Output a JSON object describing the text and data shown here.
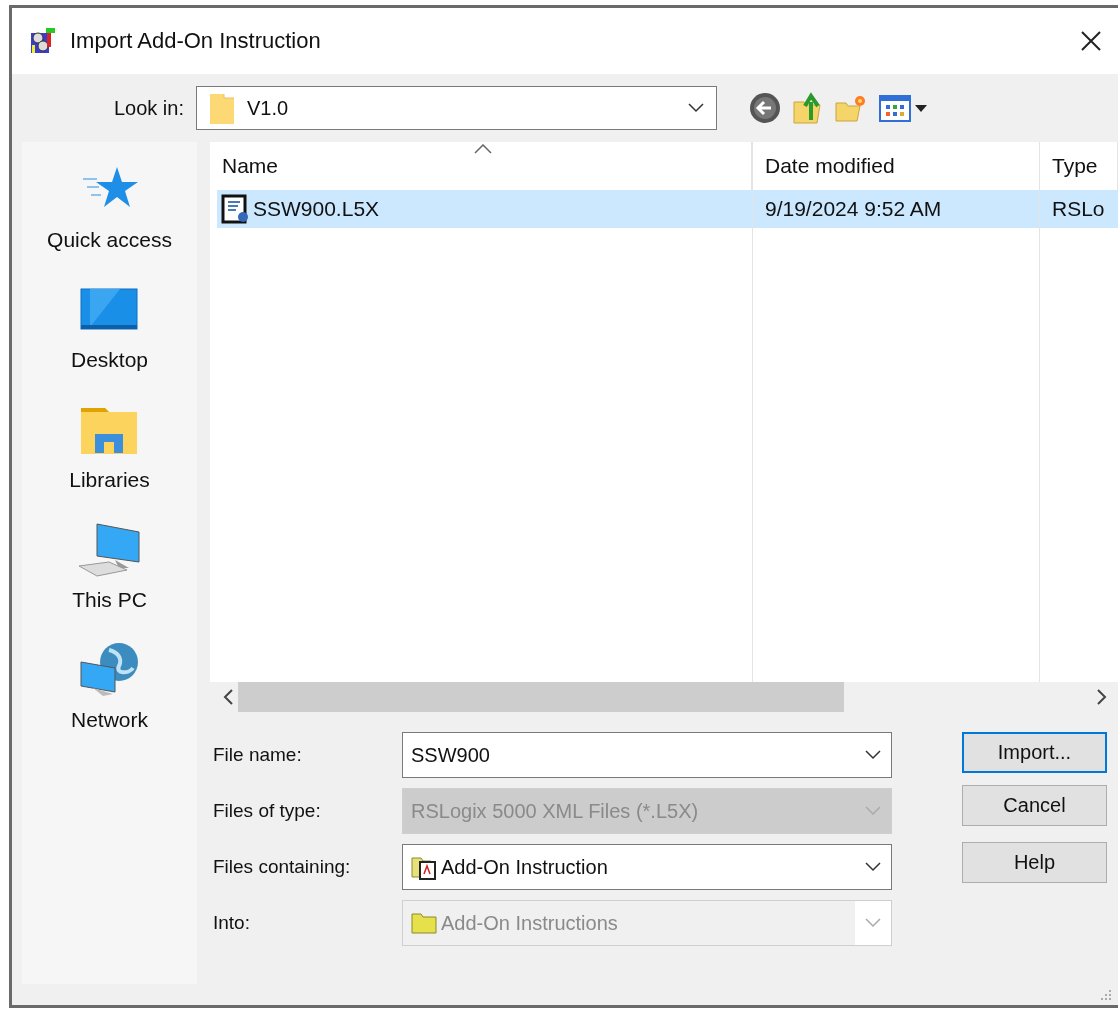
{
  "window": {
    "title": "Import Add-On Instruction"
  },
  "look_in": {
    "label": "Look in:",
    "value": "V1.0"
  },
  "places": [
    {
      "label": "Quick access",
      "kind": "star"
    },
    {
      "label": "Desktop",
      "kind": "desktop"
    },
    {
      "label": "Libraries",
      "kind": "libraries"
    },
    {
      "label": "This PC",
      "kind": "pc"
    },
    {
      "label": "Network",
      "kind": "network"
    }
  ],
  "file_list": {
    "columns": [
      "Name",
      "Date modified",
      "Type"
    ],
    "rows": [
      {
        "name": "SSW900.L5X",
        "date": "9/19/2024 9:52 AM",
        "type": "RSLo",
        "selected": true
      }
    ]
  },
  "fields": [
    {
      "label": "File name:",
      "value": "SSW900",
      "kind": "text",
      "disabled": false
    },
    {
      "label": "Files of type:",
      "value": "RSLogix 5000 XML Files (*.L5X)",
      "kind": "text",
      "disabled": true
    },
    {
      "label": "Files containing:",
      "value": "Add-On Instruction",
      "kind": "instruction",
      "disabled": false
    },
    {
      "label": "Into:",
      "value": "Add-On Instructions",
      "kind": "folder",
      "disabled": true
    }
  ],
  "buttons": [
    {
      "label": "Import...",
      "default": true
    },
    {
      "label": "Cancel",
      "default": false
    },
    {
      "label": "Help",
      "default": false
    }
  ]
}
